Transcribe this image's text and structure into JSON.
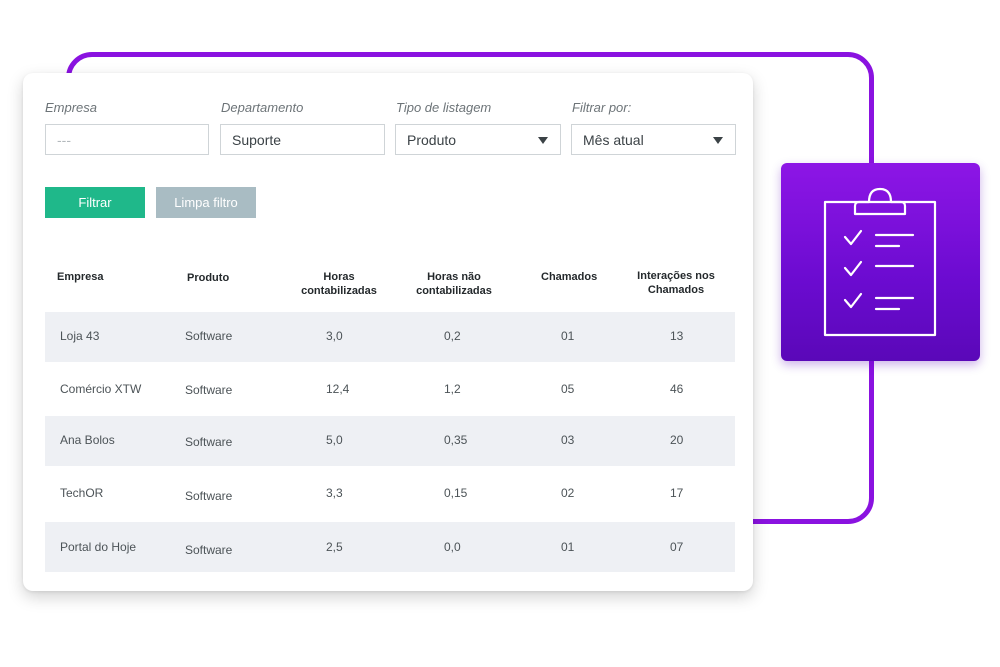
{
  "filters": {
    "empresa": {
      "label": "Empresa",
      "value": "---"
    },
    "departamento": {
      "label": "Departamento",
      "value": "Suporte"
    },
    "tipo_listagem": {
      "label": "Tipo de listagem",
      "value": "Produto"
    },
    "filtrar_por": {
      "label": "Filtrar por:",
      "value": "Mês atual"
    }
  },
  "buttons": {
    "filter_label": "Filtrar",
    "clear_label": "Limpa filtro"
  },
  "table": {
    "headers": {
      "empresa": "Empresa",
      "produto": "Produto",
      "horas_l1": "Horas",
      "horas_l2": "contabilizadas",
      "horas_nao_l1": "Horas não",
      "horas_nao_l2": "contabilizadas",
      "chamados": "Chamados",
      "interacoes_l1": "Interações nos",
      "interacoes_l2": "Chamados"
    },
    "rows": [
      {
        "empresa": "Loja 43",
        "produto": "Software",
        "horas": "3,0",
        "horas_nao": "0,2",
        "chamados": "01",
        "interacoes": "13"
      },
      {
        "empresa": "Comércio XTW",
        "produto": "Software",
        "horas": "12,4",
        "horas_nao": "1,2",
        "chamados": "05",
        "interacoes": "46"
      },
      {
        "empresa": "Ana Bolos",
        "produto": "Software",
        "horas": "5,0",
        "horas_nao": "0,35",
        "chamados": "03",
        "interacoes": "20"
      },
      {
        "empresa": "TechOR",
        "produto": "Software",
        "horas": "3,3",
        "horas_nao": "0,15",
        "chamados": "02",
        "interacoes": "17"
      },
      {
        "empresa": "Portal do Hoje",
        "produto": "Software",
        "horas": "2,5",
        "horas_nao": "0,0",
        "chamados": "01",
        "interacoes": "07"
      }
    ]
  },
  "colors": {
    "accent_purple": "#8a12e0",
    "filter_button": "#1fb88a",
    "clear_button": "#a9bcc3",
    "row_shade": "#eef0f4"
  },
  "icons": {
    "feature_icon": "clipboard-checklist-icon"
  }
}
